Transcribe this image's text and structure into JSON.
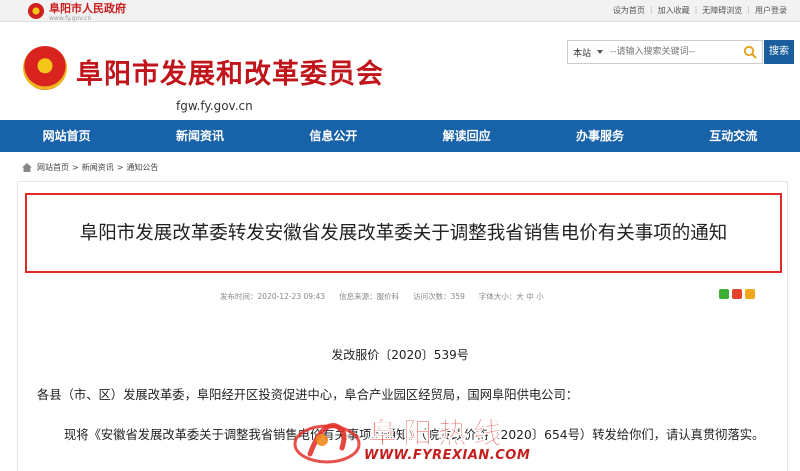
{
  "topbar": {
    "gov_name": "阜阳市人民政府",
    "gov_url": "www.fy.gov.cn",
    "links": [
      "设为首页",
      "加入收藏",
      "无障碍浏览",
      "用户登录"
    ]
  },
  "header": {
    "site_title": "阜阳市发展和改革委员会",
    "site_domain": "fgw.fy.gov.cn",
    "search": {
      "scope": "本站",
      "placeholder": "--请输入搜索关键词--",
      "button_label": "搜索"
    }
  },
  "nav": {
    "items": [
      "网站首页",
      "新闻资讯",
      "信息公开",
      "解读回应",
      "办事服务",
      "互动交流"
    ]
  },
  "breadcrumb": {
    "items": [
      "网站首页",
      "新闻资讯",
      "通知公告"
    ],
    "separator": ">"
  },
  "article": {
    "title": "阜阳市发展改革委转发安徽省发展改革委关于调整我省销售电价有关事项的通知",
    "meta": {
      "publish_time": "发布时间：2020-12-23 09:43",
      "source": "信息来源：服价科",
      "views": "访问次数：359",
      "font_size": "字体大小：大 中 小"
    },
    "doc_number": "发改服价〔2020〕539号",
    "para1": "各县（市、区）发展改革委，阜阳经开区投资促进中心，阜合产业园区经贸局，国网阜阳供电公司：",
    "para2": "现将《安徽省发展改革委关于调整我省销售电价有关事项的通知》（皖发改价格〔2020〕654号）转发给你们，请认真贯彻落实。"
  },
  "watermark": {
    "cn": "阜阳热线",
    "en": "WWW.FYREXIAN.COM"
  },
  "colors": {
    "nav_bg": "#1762a9",
    "title_red": "#c0151b",
    "highlight_border": "#e02a2a"
  }
}
